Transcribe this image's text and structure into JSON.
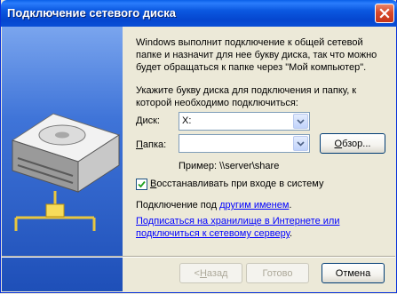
{
  "window": {
    "title": "Подключение сетевого диска"
  },
  "intro": {
    "line1": "Windows выполнит подключение к общей сетевой",
    "line2": "папке и назначит для нее букву диска, так что можно",
    "line3": "будет обращаться к папке через \"Мой компьютер\"."
  },
  "instruction": {
    "line1": "Укажите букву диска для подключения и папку, к",
    "line2": "которой необходимо подключиться:"
  },
  "drive": {
    "label_underlined": "Д",
    "label_rest": "иск:",
    "value": "X:"
  },
  "folder": {
    "label_underlined": "П",
    "label_rest": "апка:",
    "value": "",
    "browse_underlined": "О",
    "browse_rest": "бзор..."
  },
  "example": "Пример: \\\\server\\share",
  "reconnect": {
    "underlined": "В",
    "rest": "осстанавливать при входе в систему",
    "checked": true
  },
  "connect_as": {
    "prefix": "Подключение под ",
    "link": "другим именем",
    "suffix": "."
  },
  "online_storage": {
    "line1": "Подписаться на хранилище в Интернете или",
    "line2": "подключиться к сетевому серверу",
    "suffix": "."
  },
  "buttons": {
    "back": "< ",
    "back_underlined": "Н",
    "back_rest": "азад",
    "finish": "Готово",
    "cancel": "Отмена"
  }
}
